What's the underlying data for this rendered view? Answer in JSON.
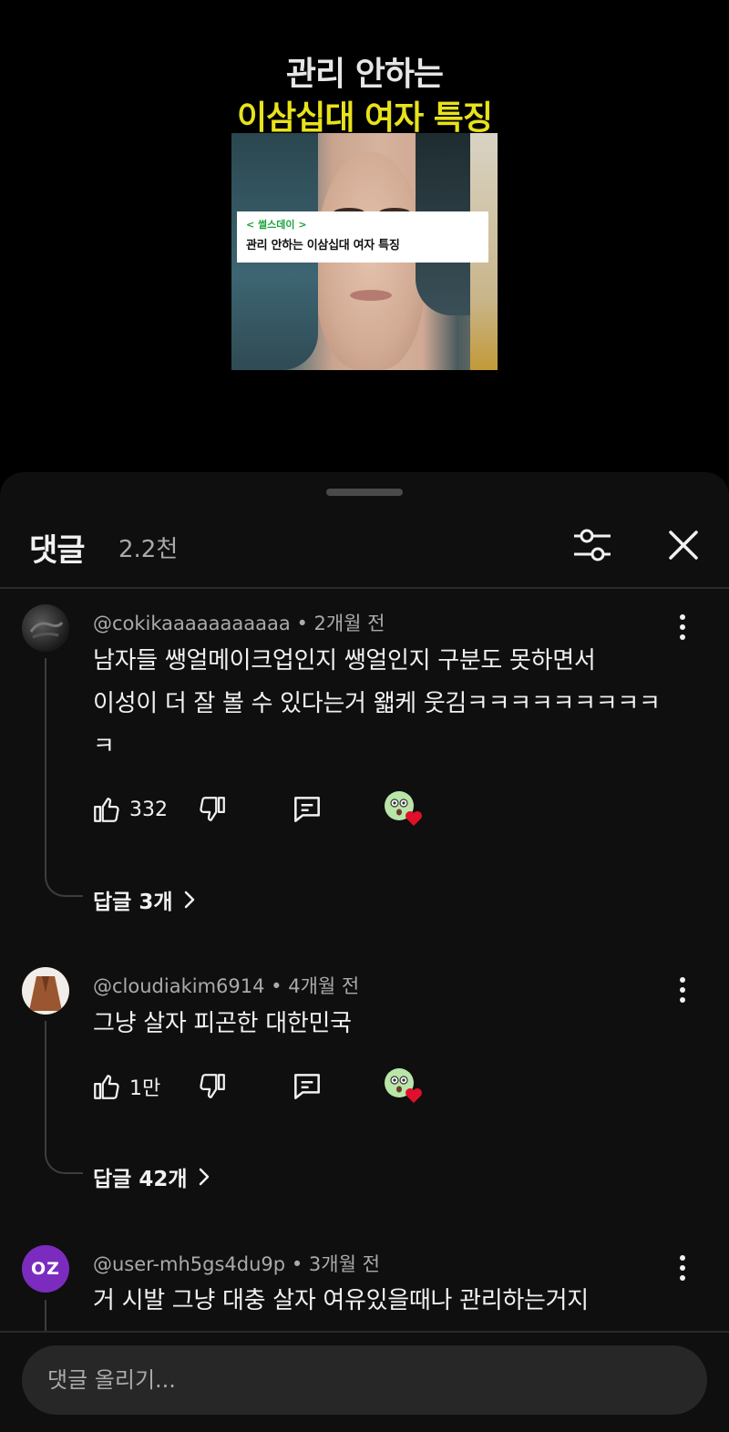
{
  "video": {
    "title_line1": "관리 안하는",
    "title_line2": "이삼십대 여자 특징",
    "caption_tag": "< 썰스데이 >",
    "caption_text": "관리 안하는 이삼십대 여자 특징"
  },
  "header": {
    "title": "댓글",
    "count": "2.2천"
  },
  "comments": [
    {
      "author": "@cokikaaaaaaaaaaa",
      "time": "2개월 전",
      "text_lines": [
        "남자들 쌩얼메이크업인지 쌩얼인지 구분도 못하면서",
        "이성이 더 잘 볼 수 있다는거 왧케 웃김ㅋㅋㅋㅋㅋㅋㅋㅋㅋ",
        "ㅋ"
      ],
      "likes": "332",
      "replies": "답글 3개"
    },
    {
      "author": "@cloudiakim6914",
      "time": "4개월 전",
      "text_lines": [
        "그냥 살자 피곤한 대한민국"
      ],
      "likes": "1만",
      "replies": "답글 42개"
    },
    {
      "author": "@user-mh5gs4du9p",
      "time": "3개월 전",
      "avatar_initials": "OZ",
      "text_lines": [
        "거 시발 그냥 대충 살자 여유있을때나 관리하는거지"
      ]
    }
  ],
  "input": {
    "placeholder": "댓글 올리기..."
  },
  "colors": {
    "background": "#0f0f0f",
    "video_title_accent": "#e8e21c",
    "avatar_oz": "#7b2cbf",
    "heart": "#e0102a"
  }
}
